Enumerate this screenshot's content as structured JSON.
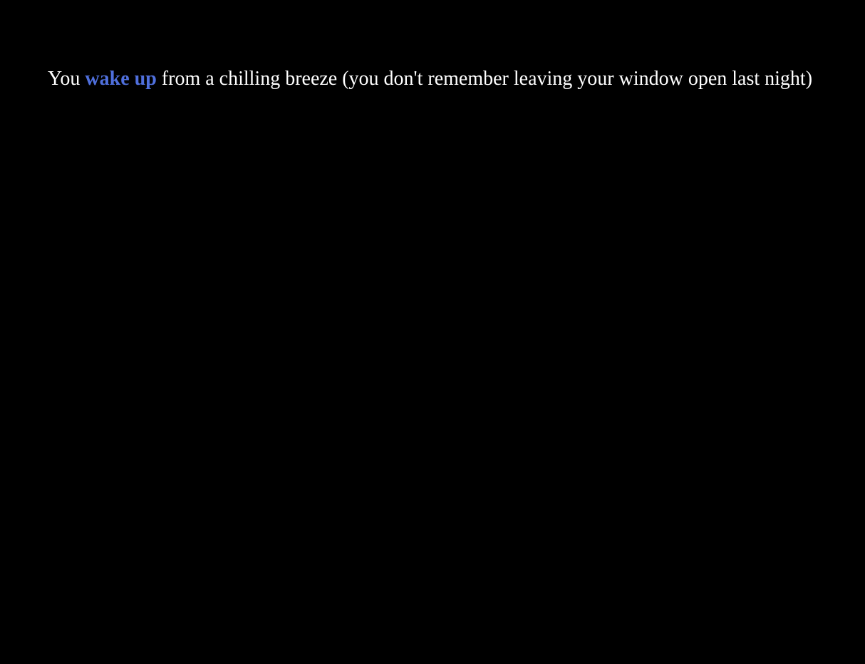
{
  "story": {
    "before": "You ",
    "link_label": "wake up",
    "after": " from a chilling breeze (you don't remember leaving your window open last night)"
  },
  "colors": {
    "background": "#000000",
    "text": "#ffffff",
    "link": "#4f6fdc"
  }
}
